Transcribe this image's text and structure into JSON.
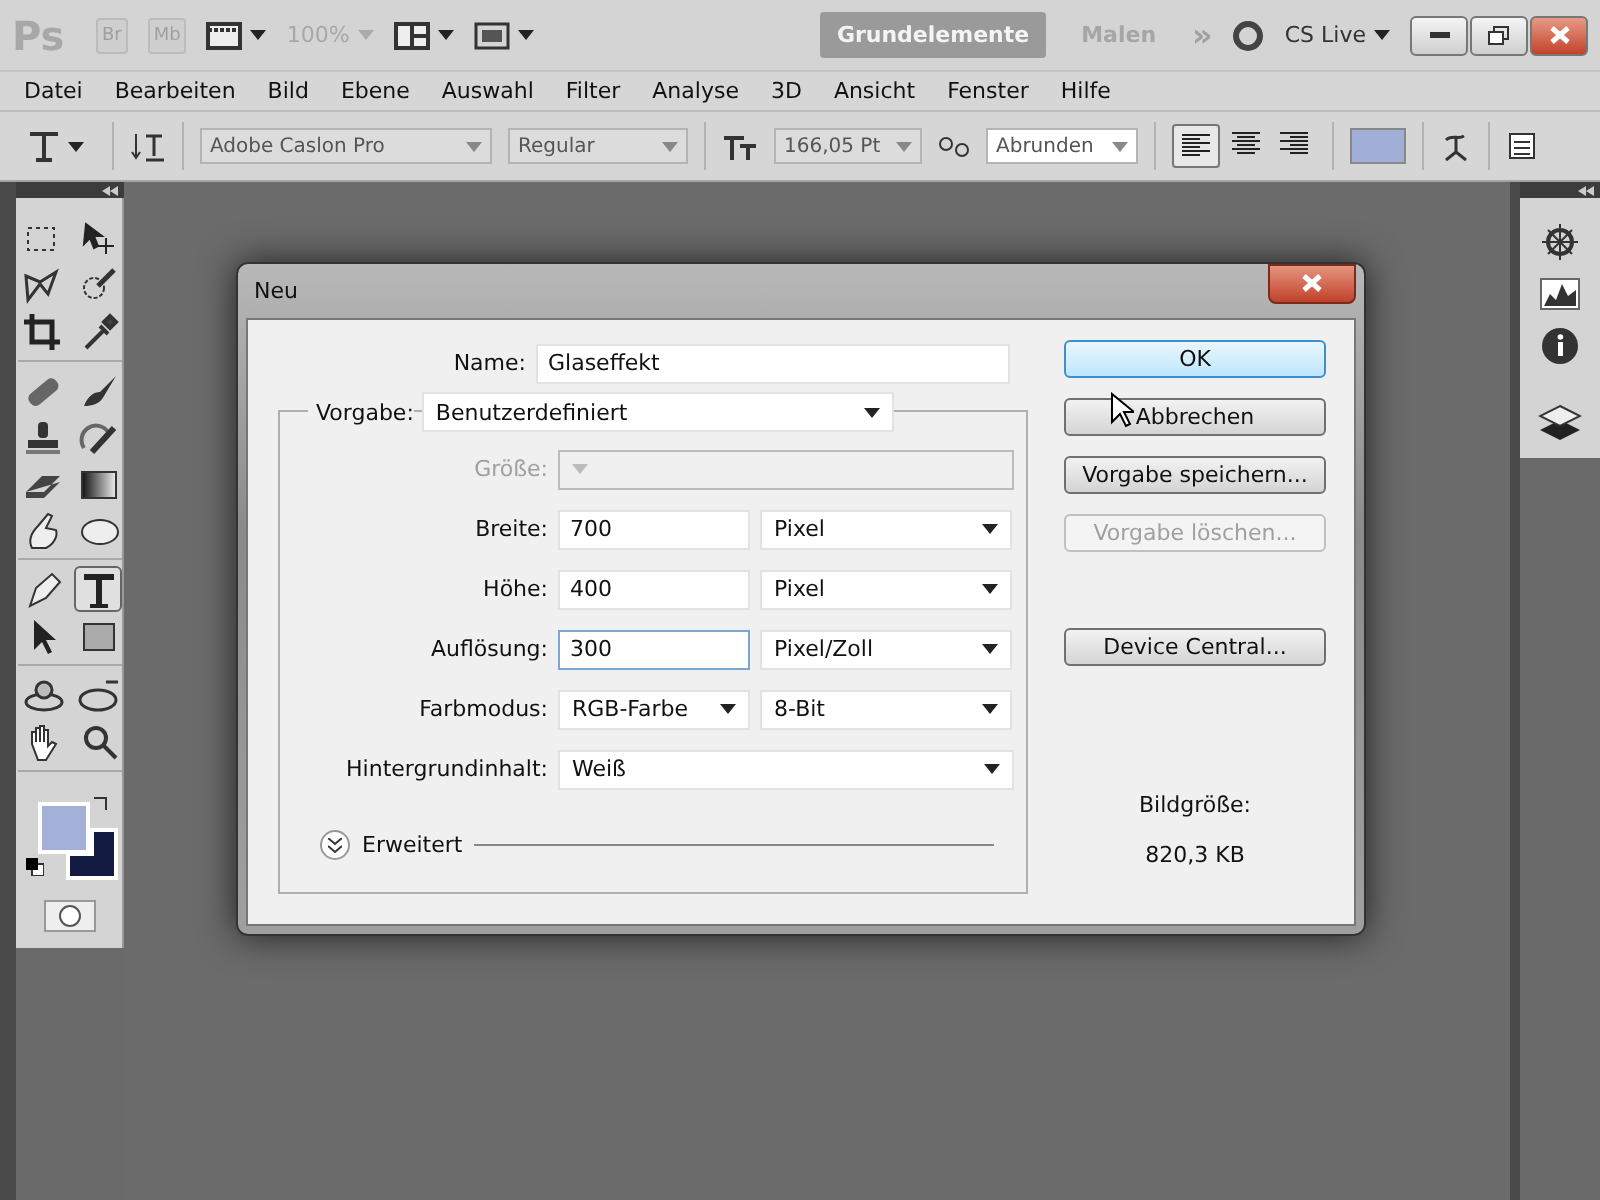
{
  "app_bar": {
    "logo": "Ps",
    "bridge": "Br",
    "mini_bridge": "Mb",
    "zoom": "100%",
    "workspaces": [
      {
        "label": "Grundelemente",
        "selected": true
      },
      {
        "label": "Malen",
        "selected": false
      }
    ],
    "more": "»",
    "cs_live": "CS Live"
  },
  "menu": [
    "Datei",
    "Bearbeiten",
    "Bild",
    "Ebene",
    "Auswahl",
    "Filter",
    "Analyse",
    "3D",
    "Ansicht",
    "Fenster",
    "Hilfe"
  ],
  "options_bar": {
    "font_family": "Adobe Caslon Pro",
    "font_style": "Regular",
    "font_size": "166,05 Pt",
    "antialias": "Abrunden",
    "align": [
      {
        "selected": true
      },
      {
        "selected": false
      },
      {
        "selected": false
      }
    ],
    "text_swatch": {
      "color": "#a0aed8"
    }
  },
  "tools": [
    {
      "selected": false
    },
    {
      "selected": false
    },
    {
      "selected": false
    },
    {
      "selected": false
    },
    {
      "selected": false
    },
    {
      "selected": false
    },
    {
      "selected": false
    },
    {
      "selected": false
    },
    {
      "selected": false
    },
    {
      "selected": false
    },
    {
      "selected": false
    },
    {
      "selected": false
    },
    {
      "selected": false
    },
    {
      "selected": false
    },
    {
      "selected": false
    },
    {
      "selected": true
    },
    {
      "selected": false
    },
    {
      "selected": false
    },
    {
      "selected": false
    },
    {
      "selected": false
    },
    {
      "selected": false
    },
    {
      "selected": false
    }
  ],
  "swatches": [
    {
      "color": "#a3b0d8"
    },
    {
      "color": "#141b42"
    }
  ],
  "dialog": {
    "title": "Neu",
    "name": {
      "label": "Name:",
      "value": "Glaseffekt"
    },
    "preset": {
      "label": "Vorgabe:",
      "value": "Benutzerdefiniert"
    },
    "rows": [
      {
        "kind": "select",
        "label": "Größe:",
        "disabled": true
      },
      {
        "kind": "input_unit",
        "label": "Breite:",
        "value": "700",
        "unit": "Pixel",
        "focused": false,
        "disabled": false
      },
      {
        "kind": "input_unit",
        "label": "Höhe:",
        "value": "400",
        "unit": "Pixel",
        "focused": false,
        "disabled": false
      },
      {
        "kind": "input_unit",
        "label": "Auflösung:",
        "value": "300",
        "unit": "Pixel/Zoll",
        "focused": true,
        "disabled": false
      },
      {
        "kind": "select_pair",
        "label": "Farbmodus:",
        "value": "RGB-Farbe",
        "unit": "8-Bit",
        "disabled": false
      },
      {
        "kind": "select",
        "label": "Hintergrundinhalt:",
        "value": "Weiß",
        "disabled": false
      }
    ],
    "advanced": {
      "label": "Erweitert",
      "expanded": false
    },
    "buttons": [
      {
        "label": "OK",
        "default": true,
        "disabled": false
      },
      {
        "label": "Abbrechen",
        "default": false,
        "disabled": false
      },
      {
        "label": "Vorgabe speichern...",
        "default": false,
        "disabled": false
      },
      {
        "label": "Vorgabe löschen...",
        "default": false,
        "disabled": true
      },
      {
        "label": "Device Central...",
        "default": false,
        "disabled": false
      }
    ],
    "image_size": {
      "label": "Bildgröße:",
      "value": "820,3 KB"
    }
  }
}
